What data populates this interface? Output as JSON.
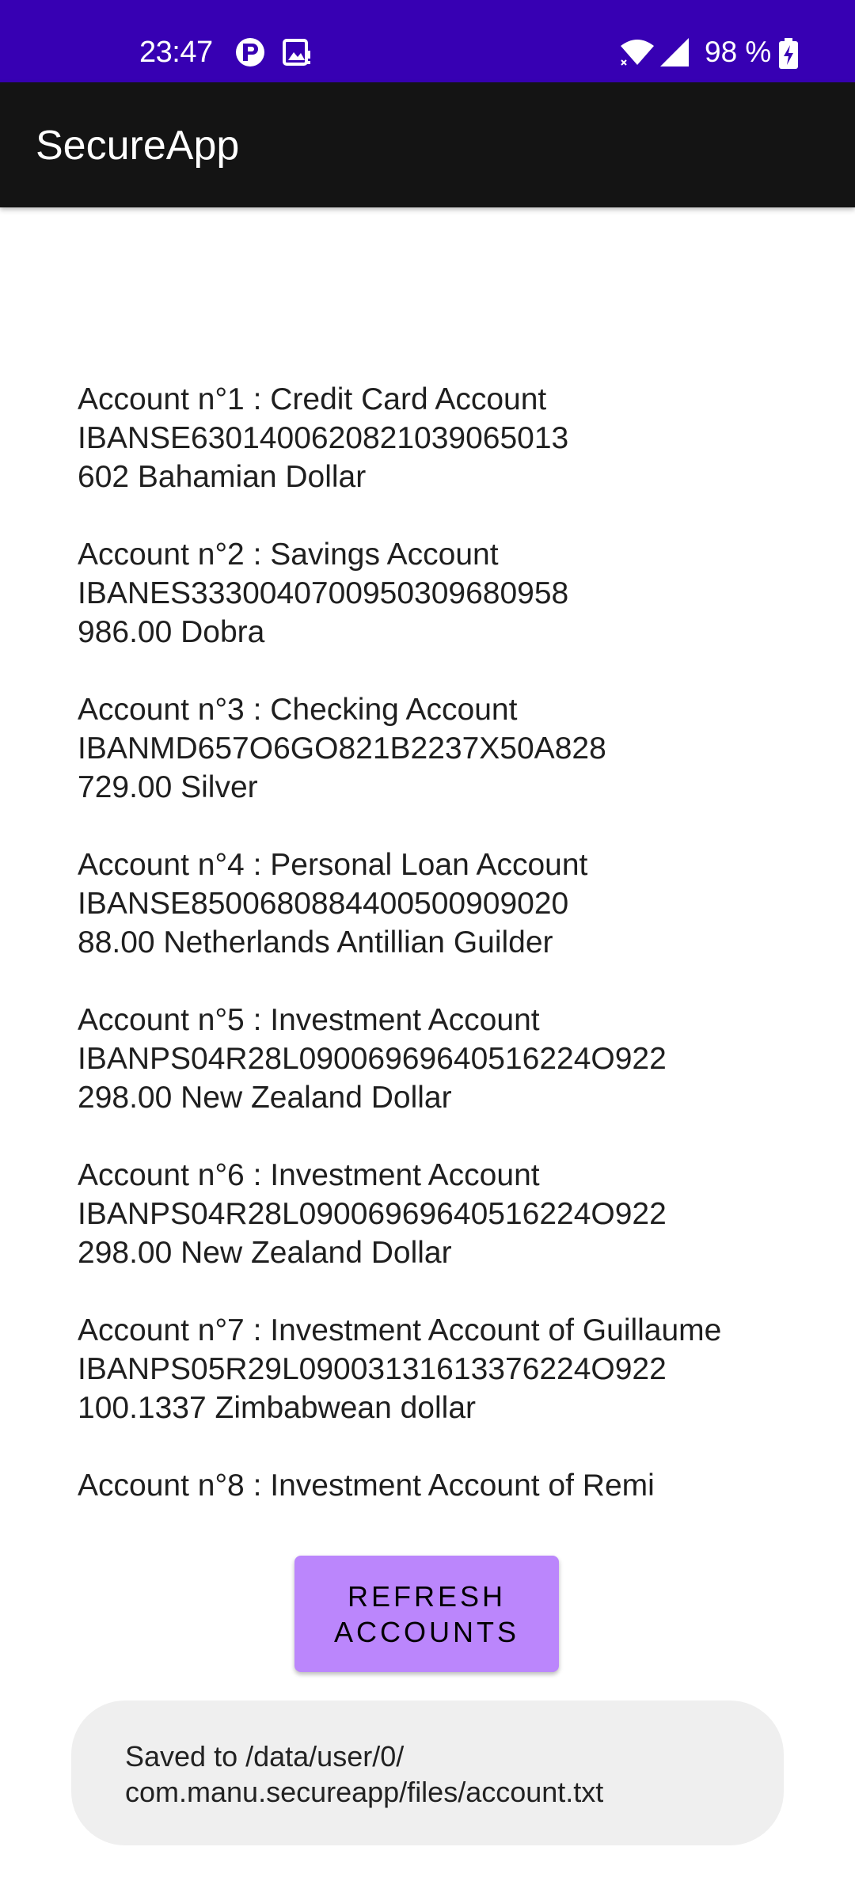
{
  "status_bar": {
    "time": "23:47",
    "left_icons": [
      "notification-p-icon",
      "image-notification-icon"
    ],
    "right_icons": [
      "wifi-icon",
      "signal-icon",
      "battery-charging-icon"
    ],
    "battery_text": "98 %",
    "background": "#3700b3"
  },
  "app_bar": {
    "title": "SecureApp",
    "background": "#141414"
  },
  "accounts": [
    {
      "header": "Account n°1 : Credit Card Account",
      "iban": "IBANSE6301400620821039065013",
      "balance": "602 Bahamian Dollar"
    },
    {
      "header": "Account n°2 : Savings Account",
      "iban": "IBANES3330040700950309680958",
      "balance": "986.00 Dobra"
    },
    {
      "header": "Account n°3 : Checking Account",
      "iban": "IBANMD657O6GO821B2237X50A828",
      "balance": "729.00 Silver"
    },
    {
      "header": "Account n°4 : Personal Loan Account",
      "iban": "IBANSE8500680884400500909020",
      "balance": "88.00 Netherlands Antillian Guilder"
    },
    {
      "header": "Account n°5 : Investment Account",
      "iban": "IBANPS04R28L09006969640516224O922",
      "balance": "298.00 New Zealand Dollar"
    },
    {
      "header": "Account n°6 : Investment Account",
      "iban": "IBANPS04R28L09006969640516224O922",
      "balance": "298.00 New Zealand Dollar"
    },
    {
      "header": "Account n°7 : Investment Account of Guillaume",
      "iban": "IBANPS05R29L09003131613376224O922",
      "balance": "100.1337 Zimbabwean dollar"
    },
    {
      "header": "Account n°8 : Investment Account of Remi"
    }
  ],
  "refresh_button": {
    "line1": "REFRESH",
    "line2": "ACCOUNTS",
    "color": "#bb86fc"
  },
  "toast": {
    "line1": "Saved to /data/user/0/",
    "line2": "com.manu.secureapp/files/account.txt"
  }
}
